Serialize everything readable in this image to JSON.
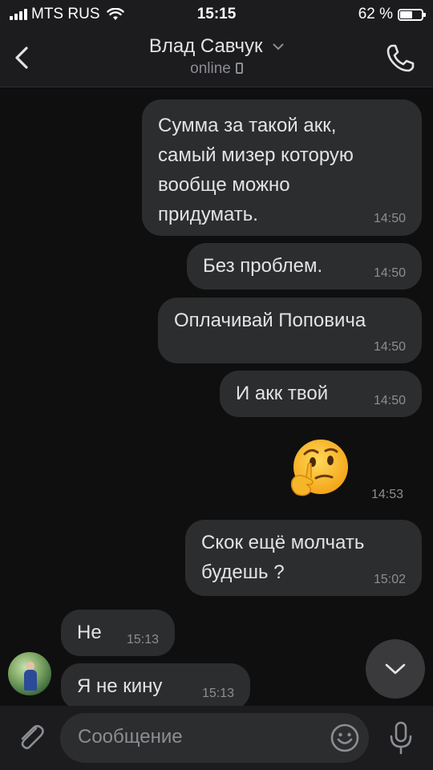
{
  "status_bar": {
    "carrier": "MTS RUS",
    "time": "15:15",
    "battery": "62 %",
    "battery_level": 0.62
  },
  "header": {
    "contact_name": "Влад Савчук",
    "presence": "online"
  },
  "messages": [
    {
      "text": "Сумма за такой акк,\nсамый мизер которую\nвообще можно\nпридумать.",
      "time": "14:50",
      "outgoing": true
    },
    {
      "text": "Без проблем.",
      "time": "14:50",
      "outgoing": true
    },
    {
      "text": "Оплачивай Поповича",
      "time": "14:50",
      "outgoing": true
    },
    {
      "text": "И акк твой",
      "time": "14:50",
      "outgoing": true
    },
    {
      "text": "🤔",
      "time": "14:53",
      "outgoing": true
    },
    {
      "text": "Скок ещё молчать\nбудешь ?",
      "time": "15:02",
      "outgoing": true
    },
    {
      "text": "Не",
      "time": "15:13",
      "outgoing": false
    },
    {
      "text": "Я не кину",
      "time": "15:13",
      "outgoing": false
    }
  ],
  "composer": {
    "placeholder": "Сообщение"
  },
  "colors": {
    "background": "#0f0f0f",
    "bubble": "#2c2d2e",
    "bar": "#1c1c1e",
    "muted": "#8b8e93"
  }
}
